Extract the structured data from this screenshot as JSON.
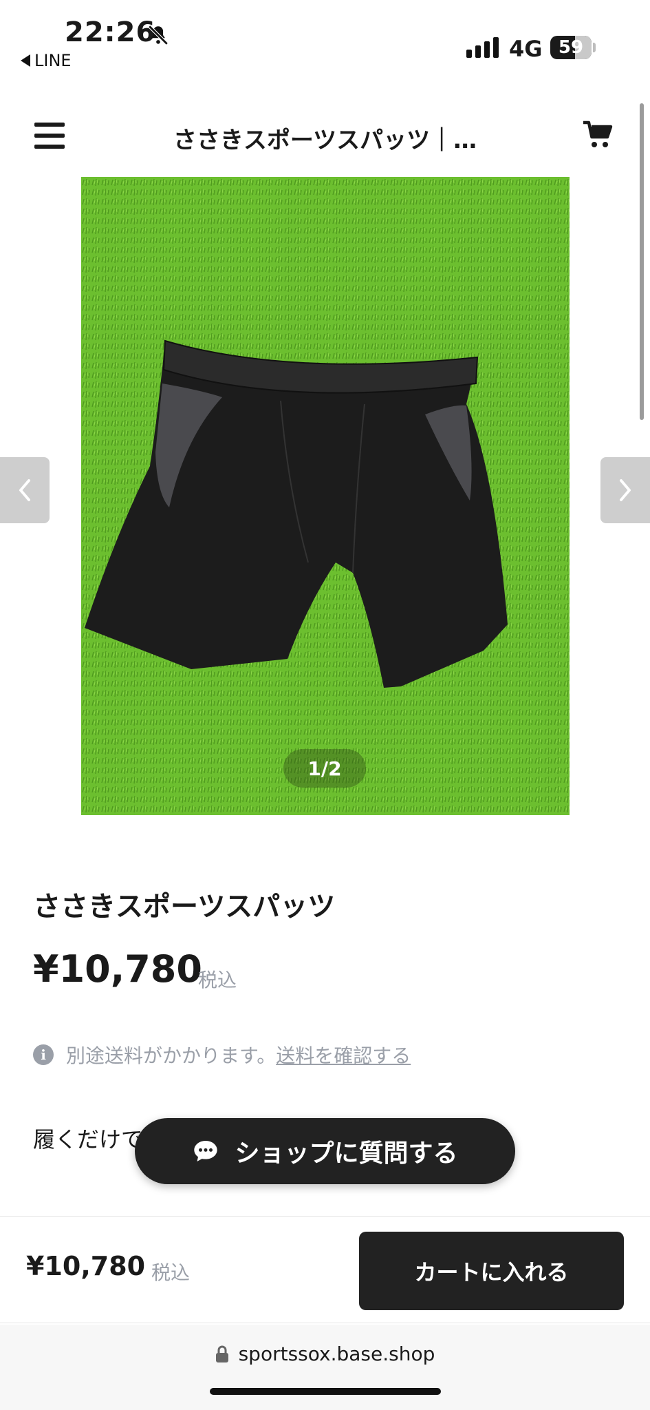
{
  "status_bar": {
    "time": "22:26",
    "back_app": "LINE",
    "network": "4G",
    "battery": "59",
    "icons": [
      "bell-slash-icon",
      "signal-icon",
      "battery-icon"
    ]
  },
  "header": {
    "title": "ささきスポーツスパッツ｜…",
    "icons": [
      "menu-icon",
      "cart-icon"
    ]
  },
  "gallery": {
    "counter": "1/2",
    "icons": [
      "chevron-left-icon",
      "chevron-right-icon"
    ],
    "colors": {
      "grass": "#6cbf2f",
      "garment": "#1c1c1c",
      "mesh": "#4a4a4e"
    }
  },
  "product": {
    "title": "ささきスポーツスパッツ",
    "price": "¥10,780",
    "tax_label": "税込",
    "shipping_note": "別途送料がかかります。",
    "shipping_link": "送料を確認する",
    "description_partial": "履くだけで"
  },
  "ask_button": {
    "label": "ショップに質問する",
    "icon": "chat-bubble-icon"
  },
  "buy_bar": {
    "price": "¥10,780",
    "tax_label": "税込",
    "cart_button": "カートに入れる"
  },
  "browser": {
    "url": "sportssox.base.shop",
    "icon": "lock-icon"
  },
  "colors": {
    "dark_button": "#222222",
    "muted_text": "#9a9fa8"
  }
}
